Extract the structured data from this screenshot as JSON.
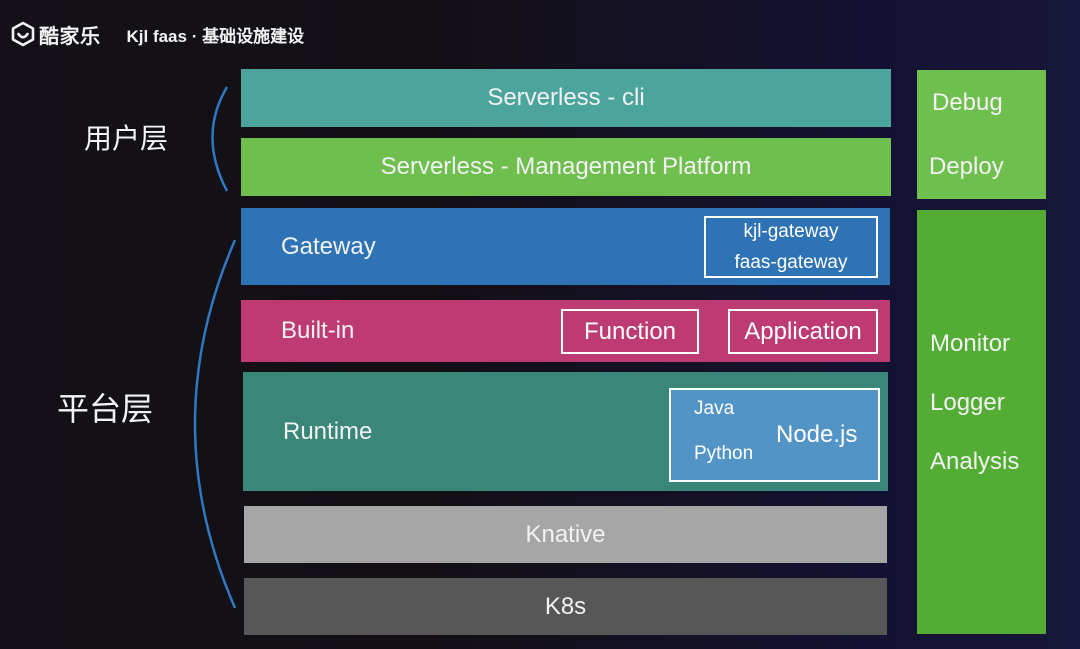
{
  "header": {
    "logo_icon": "shield-smile-icon",
    "brand": "酷家乐",
    "subtitle": "Kjl faas · 基础设施建设"
  },
  "layers": {
    "user_layer_label": "用户层",
    "platform_layer_label": "平台层"
  },
  "colors": {
    "cli": "#4ba59c",
    "management": "#6fbf4f",
    "gateway": "#2e73b6",
    "builtin": "#bd3b72",
    "runtime": "#3a8679",
    "runtime_box": "#5394c6",
    "knative": "#a6a6a6",
    "k8s": "#575757",
    "debug_deploy": "#6fbf4f",
    "monitor": "#53ad35",
    "bracket": "#2f78c4"
  },
  "stack": {
    "cli": "Serverless - cli",
    "management": "Serverless - Management Platform",
    "gateway": {
      "label": "Gateway",
      "items": [
        "kjl-gateway",
        "faas-gateway"
      ]
    },
    "builtin": {
      "label": "Built-in",
      "function": "Function",
      "application": "Application"
    },
    "runtime": {
      "label": "Runtime",
      "languages": {
        "java": "Java",
        "python": "Python",
        "nodejs": "Node.js"
      }
    },
    "knative": "Knative",
    "k8s": "K8s"
  },
  "side": {
    "tools": [
      "Debug",
      "Deploy"
    ],
    "ops": [
      "Monitor",
      "Logger",
      "Analysis"
    ]
  }
}
